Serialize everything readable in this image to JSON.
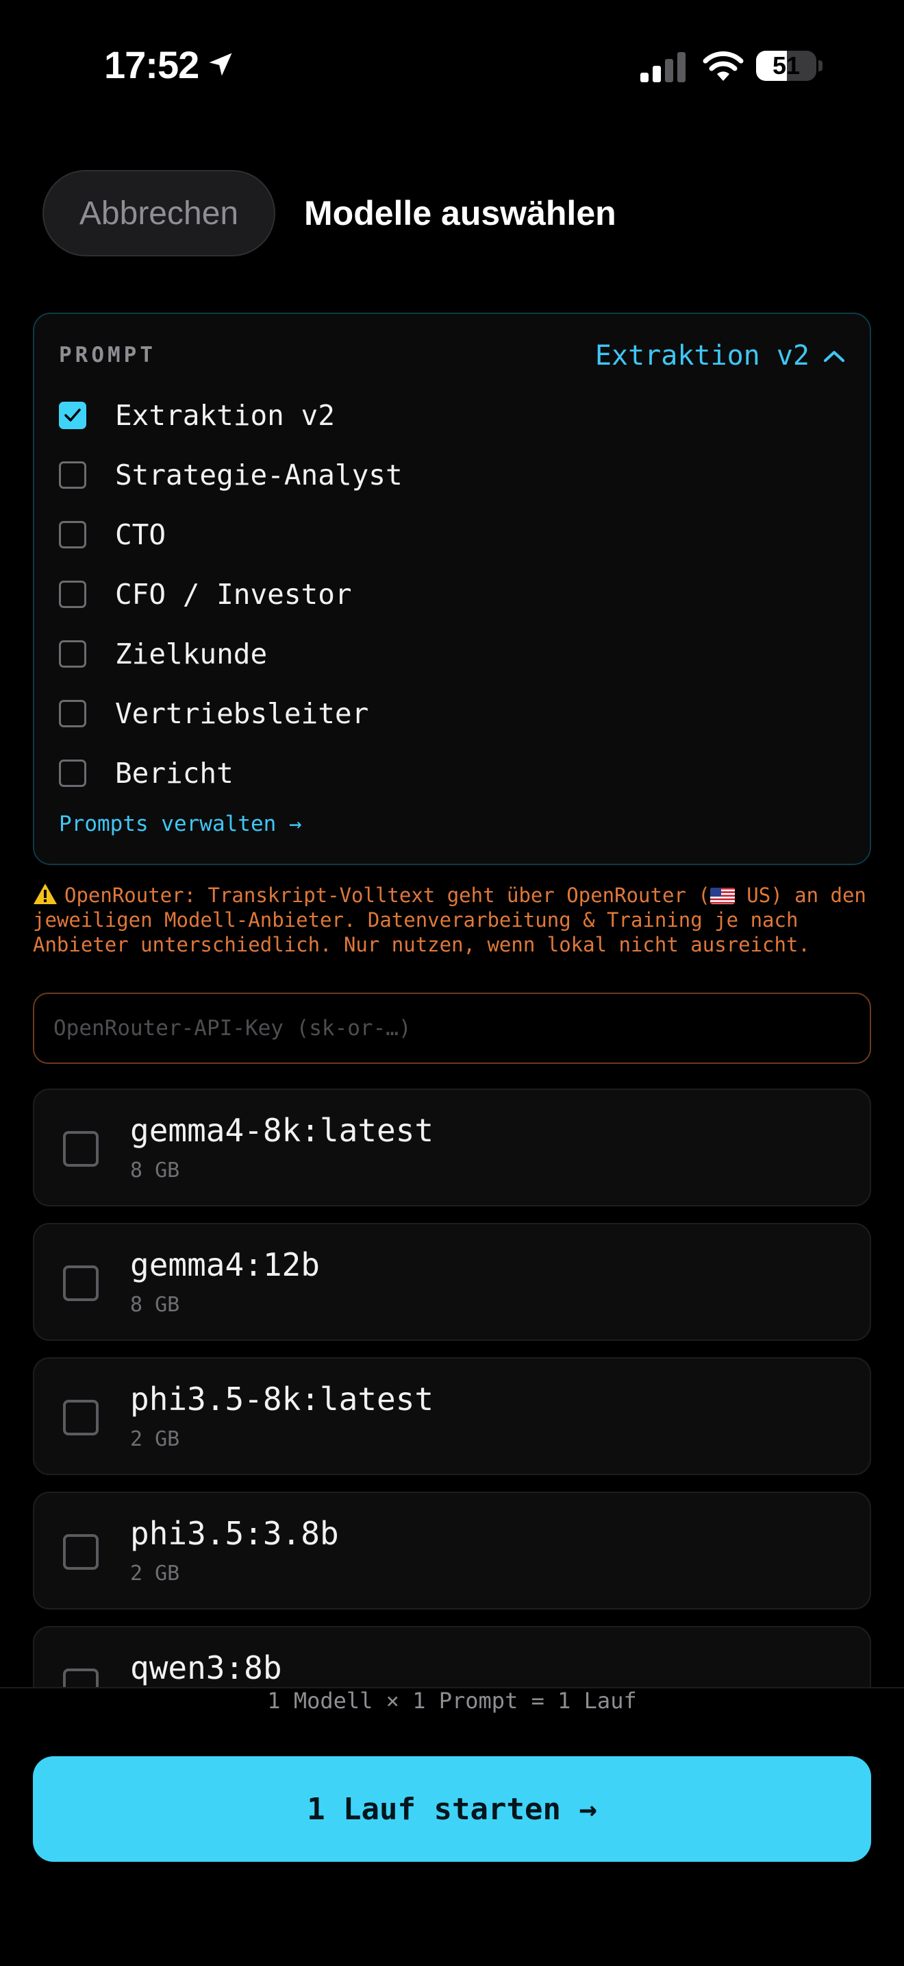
{
  "status_bar": {
    "time": "17:52",
    "battery": "51",
    "battery_level": 0.51,
    "icons": [
      "location-arrow-icon",
      "signal-icon",
      "wifi-icon",
      "battery-icon"
    ]
  },
  "header": {
    "cancel_label": "Abbrechen",
    "title": "Modelle auswählen"
  },
  "prompt_section": {
    "label": "PROMPT",
    "selected": "Extraktion v2",
    "items": [
      {
        "label": "Extraktion v2",
        "checked": true
      },
      {
        "label": "Strategie-Analyst",
        "checked": false
      },
      {
        "label": "CTO",
        "checked": false
      },
      {
        "label": "CFO / Investor",
        "checked": false
      },
      {
        "label": "Zielkunde",
        "checked": false
      },
      {
        "label": "Vertriebsleiter",
        "checked": false
      },
      {
        "label": "Bericht",
        "checked": false
      }
    ],
    "manage_link": "Prompts verwalten →"
  },
  "warning": {
    "text_before_flag": "OpenRouter: Transkript-Volltext geht über OpenRouter (",
    "text_after_flag": " US) an den jeweiligen Modell-Anbieter. Datenverarbeitung & Training je nach Anbieter unterschiedlich. Nur nutzen, wenn lokal nicht ausreicht."
  },
  "api_key": {
    "value": "",
    "placeholder": "OpenRouter-API-Key (sk-or-…)"
  },
  "models": [
    {
      "name": "gemma4-8k:latest",
      "size": "8 GB",
      "checked": false
    },
    {
      "name": "gemma4:12b",
      "size": "8 GB",
      "checked": false
    },
    {
      "name": "phi3.5-8k:latest",
      "size": "2 GB",
      "checked": false
    },
    {
      "name": "phi3.5:3.8b",
      "size": "2 GB",
      "checked": false
    },
    {
      "name": "qwen3:8b",
      "size": "",
      "checked": false
    }
  ],
  "footer": {
    "summary": "1 Modell × 1 Prompt = 1 Lauf",
    "start_button": "1 Lauf starten →"
  },
  "colors": {
    "accent": "#3fd4f7",
    "warning": "#e0783a",
    "background": "#000000"
  }
}
